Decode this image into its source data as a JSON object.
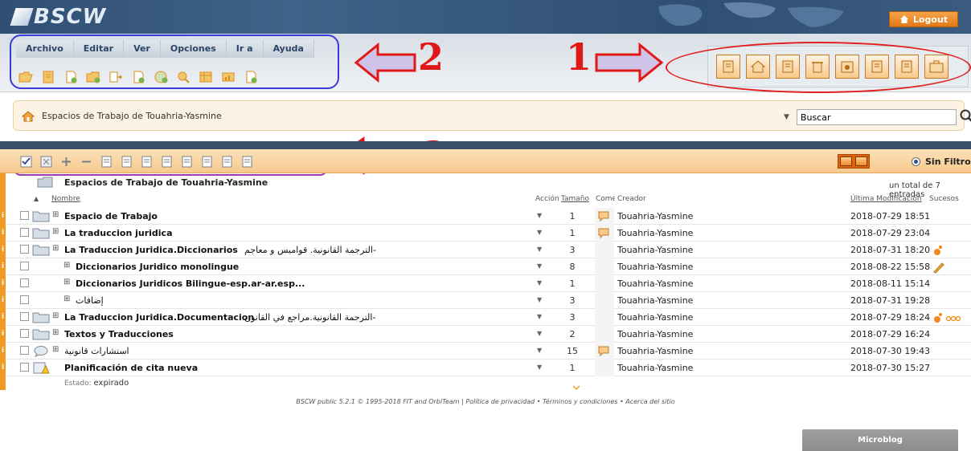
{
  "header": {
    "logo_text": "BSCW",
    "logout_label": "Logout"
  },
  "menu": {
    "items": [
      "Archivo",
      "Editar",
      "Ver",
      "Opciones",
      "Ir a",
      "Ayuda"
    ]
  },
  "toolbar_icons": [
    "open-folder-icon",
    "note-icon",
    "add-document-icon",
    "add-folder-icon",
    "move-icon",
    "new-document-icon",
    "add-url-icon",
    "add-search-icon",
    "add-table-icon",
    "add-poll-icon",
    "add-note-icon"
  ],
  "panel_buttons": [
    "clipboard-icon",
    "home-icon",
    "bag-icon",
    "trash-icon",
    "calendar-icon",
    "contacts-icon",
    "address-book-icon",
    "briefcase-icon"
  ],
  "annotations": {
    "one": "1",
    "two": "2",
    "three": "3"
  },
  "breadcrumb": {
    "text": "Espacios de Trabajo de Touahria-Yasmine"
  },
  "search": {
    "placeholder": "Buscar",
    "value": "Buscar"
  },
  "action_icons": [
    "select-all-icon",
    "deselect-icon",
    "expand-icon",
    "collapse-icon",
    "cut-icon",
    "copy-icon",
    "move-icon",
    "paste-icon",
    "delete-icon",
    "archive-icon",
    "export-icon",
    "print-icon"
  ],
  "filter": {
    "label": "Sin Filtro"
  },
  "folder": {
    "title": "Espacios de Trabajo de Touahria-Yasmine",
    "total": "un total de 7 entradas"
  },
  "columns": {
    "name": "Nombre",
    "action": "Acción",
    "size": "Tamaño",
    "comments": "Come",
    "creator": "Creador",
    "modified": "Última Modificación",
    "events": "Sucesos"
  },
  "rows": [
    {
      "name": "Espacio de Trabajo",
      "bold": true,
      "indent": 0,
      "icon": "folder-icon",
      "size": "1",
      "comment": true,
      "creator": "Touahria-Yasmine",
      "date": "2018-07-29 18:51",
      "event": ""
    },
    {
      "name": "La traduccion juridica",
      "bold": true,
      "indent": 0,
      "icon": "folder-icon",
      "size": "1",
      "comment": true,
      "creator": "Touahria-Yasmine",
      "date": "2018-07-29 23:04",
      "event": ""
    },
    {
      "name": "La Traduccion Juridica.Diccionarios",
      "name_ar": "الترجمة القانونية. قواميس و معاجم-",
      "bold": true,
      "indent": 0,
      "icon": "folder-icon",
      "size": "3",
      "comment": false,
      "creator": "Touahria-Yasmine",
      "date": "2018-07-31 18:20",
      "event": "new-icon"
    },
    {
      "name": "Diccionarios Juridico monolingue",
      "bold": true,
      "indent": 1,
      "icon": "",
      "size": "8",
      "comment": false,
      "creator": "Touahria-Yasmine",
      "date": "2018-08-22 15:58",
      "event": "edit-icon"
    },
    {
      "name": "Diccionarios Juridicos Bilingue-esp.ar-ar.esp...",
      "bold": true,
      "indent": 1,
      "icon": "",
      "size": "1",
      "comment": false,
      "creator": "Touahria-Yasmine",
      "date": "2018-08-11 15:14",
      "event": ""
    },
    {
      "name": "إضافات",
      "bold": false,
      "indent": 1,
      "icon": "",
      "size": "3",
      "comment": false,
      "creator": "Touahria-Yasmine",
      "date": "2018-07-31 19:28",
      "event": ""
    },
    {
      "name": "La Traduccion Juridica.Documentacion",
      "name_ar": "الترجمة القانونية.مراجع في القانون-",
      "bold": true,
      "indent": 0,
      "icon": "folder-icon",
      "size": "3",
      "comment": false,
      "creator": "Touahria-Yasmine",
      "date": "2018-07-29 18:24",
      "event": "new-read-icon"
    },
    {
      "name": "Textos y Traducciones",
      "bold": true,
      "indent": 0,
      "icon": "folder-icon",
      "size": "2",
      "comment": false,
      "creator": "Touahria-Yasmine",
      "date": "2018-07-29 16:24",
      "event": ""
    },
    {
      "name": "استشارات قانونية",
      "bold": false,
      "indent": 0,
      "icon": "discussion-icon",
      "size": "15",
      "comment": true,
      "creator": "Touahria-Yasmine",
      "date": "2018-07-30 19:43",
      "event": ""
    },
    {
      "name": "Planificación de cita nueva",
      "bold": true,
      "indent": 0,
      "icon": "appointment-warning-icon",
      "size": "1",
      "comment": false,
      "creator": "Touahria-Yasmine",
      "date": "2018-07-30 15:27",
      "event": ""
    }
  ],
  "estado": {
    "label": "Estado:",
    "value": "expirado"
  },
  "footer": {
    "product": "BSCW public 5.2.1",
    "copyright": "© 1995-2018 FIT and OrbiTeam",
    "privacy": "Política de privacidad",
    "terms": "Términos y condiciones",
    "about": "Acerca del sitio"
  },
  "microblog": {
    "label": "Microblog"
  },
  "colors": {
    "header_bg": "#304f72",
    "accent_orange": "#f19a21",
    "logout_bg": "#e07a16",
    "annotation_red": "#e01818",
    "annotation_blue": "#3a3ad8",
    "annotation_purple": "#9a3db5"
  }
}
